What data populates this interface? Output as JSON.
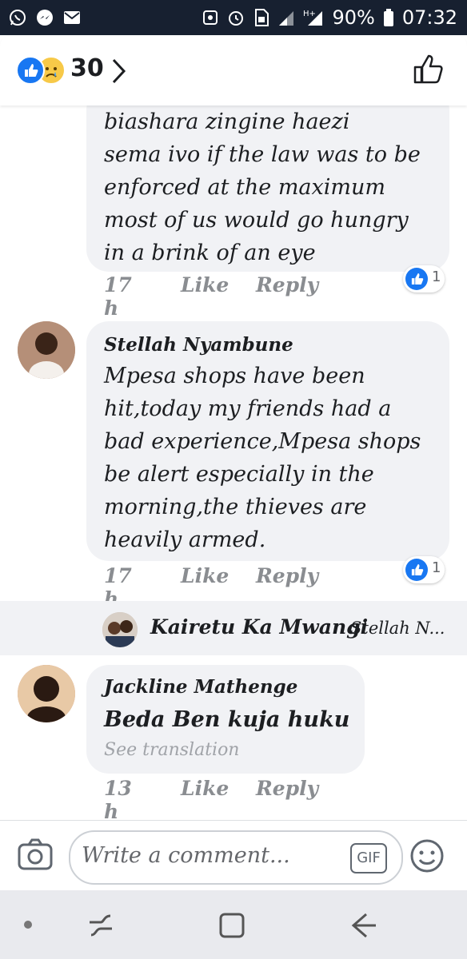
{
  "status_bar": {
    "battery": "90%",
    "time": "07:32"
  },
  "header": {
    "reaction_count": "30"
  },
  "comments": [
    {
      "text": "biashara zingine haezi sema ivo if the law was to be enforced at the maximum most of us would go hungry in a brink of an eye",
      "lines": [
        "biashara zingine haezi",
        "sema ivo if the law was to be",
        "enforced at the maximum",
        "most of us would go hungry",
        "in a brink of an eye"
      ],
      "time": "17 h",
      "like_label": "Like",
      "reply_label": "Reply",
      "reaction_count": "1"
    },
    {
      "author": "Stellah Nyambune",
      "lines": [
        "Mpesa shops have been",
        "hit,today my friends had a",
        "bad experience,Mpesa shops",
        "be alert especially in the",
        "morning,the thieves are",
        "heavily armed."
      ],
      "time": "17 h",
      "like_label": "Like",
      "reply_label": "Reply",
      "reaction_count": "1"
    },
    {
      "author": "Jackline Mathenge",
      "lines": [
        "Beda Ben kuja huku"
      ],
      "see_translation": "See translation",
      "time": "13 h",
      "like_label": "Like",
      "reply_label": "Reply"
    }
  ],
  "reply_preview": {
    "author": "Kairetu Ka Mwangi",
    "snippet": "Stellah N..."
  },
  "composer": {
    "placeholder": "Write a comment...",
    "gif_label": "GIF"
  },
  "colors": {
    "status_bar": "#172030",
    "bubble": "#f1f2f5",
    "like_blue": "#1877f2",
    "meta_gray": "#8a8d91"
  }
}
